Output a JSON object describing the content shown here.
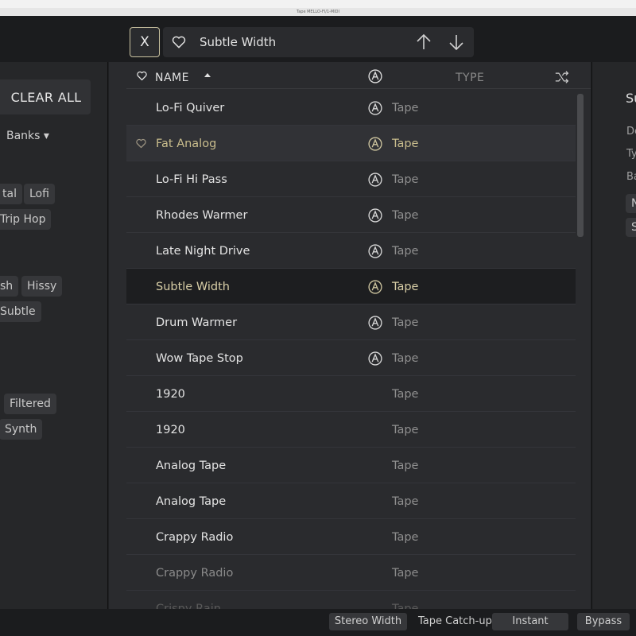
{
  "window_title": "Tape MELLO-FI/1-MIDI",
  "topbar": {
    "close_label": "X",
    "preset_name": "Subtle Width",
    "icons": [
      "heart-icon",
      "arrow-up-icon",
      "arrow-down-icon"
    ]
  },
  "left_panel": {
    "clear_all": "CLEAR ALL",
    "banks": "Banks ▾",
    "chips": [
      "tal",
      "Lofi",
      "Trip Hop",
      "sh",
      "Hissy",
      "Subtle",
      "Filtered",
      "Synth"
    ]
  },
  "list": {
    "header": {
      "name": "NAME",
      "type": "TYPE"
    },
    "rows": [
      {
        "name": "Lo-Fi Quiver",
        "type": "Tape",
        "factory": true,
        "state": "normal"
      },
      {
        "name": "Fat Analog",
        "type": "Tape",
        "factory": true,
        "state": "hover"
      },
      {
        "name": "Lo-Fi Hi Pass",
        "type": "Tape",
        "factory": true,
        "state": "normal"
      },
      {
        "name": "Rhodes Warmer",
        "type": "Tape",
        "factory": true,
        "state": "normal"
      },
      {
        "name": "Late Night Drive",
        "type": "Tape",
        "factory": true,
        "state": "normal"
      },
      {
        "name": "Subtle Width",
        "type": "Tape",
        "factory": true,
        "state": "selected"
      },
      {
        "name": "Drum Warmer",
        "type": "Tape",
        "factory": true,
        "state": "normal"
      },
      {
        "name": "Wow Tape Stop",
        "type": "Tape",
        "factory": true,
        "state": "normal"
      },
      {
        "name": "1920",
        "type": "Tape",
        "factory": false,
        "state": "normal"
      },
      {
        "name": "1920",
        "type": "Tape",
        "factory": false,
        "state": "normal"
      },
      {
        "name": "Analog Tape",
        "type": "Tape",
        "factory": false,
        "state": "normal"
      },
      {
        "name": "Analog Tape",
        "type": "Tape",
        "factory": false,
        "state": "normal"
      },
      {
        "name": "Crappy Radio",
        "type": "Tape",
        "factory": false,
        "state": "normal"
      },
      {
        "name": "Crappy Radio",
        "type": "Tape",
        "factory": false,
        "state": "dim"
      },
      {
        "name": "Crispy Rain",
        "type": "Tape",
        "factory": false,
        "state": "dim2"
      }
    ]
  },
  "right_panel": {
    "title": "Su",
    "labels": [
      "De",
      "Ty",
      "Ba"
    ],
    "chips": [
      "N",
      "S"
    ]
  },
  "bottombar": {
    "stereo_width": "Stereo Width",
    "tape_catchup": "Tape Catch-up",
    "instant": "Instant",
    "bypass": "Bypass"
  },
  "colors": {
    "accent": "#c9bd8d",
    "background": "#2a2b2e",
    "selected_row": "#1d1e20"
  }
}
